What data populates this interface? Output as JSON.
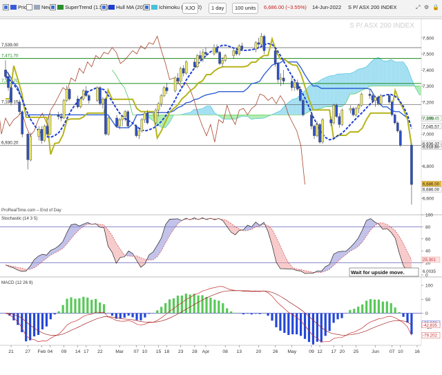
{
  "toolbar": {
    "items": [
      {
        "label": "Price",
        "checked": true,
        "swatch": "#3a5bd9"
      },
      {
        "label": "News",
        "checked": false,
        "swatch": "#9aa7b8"
      },
      {
        "label": "SuperTrend (1.5 7)",
        "checked": true,
        "swatch": "#2a8e2a"
      },
      {
        "label": "Hull MA (20)",
        "checked": true,
        "swatch": "#1f3fd0"
      },
      {
        "label": "Ichimoku (9 26 52)",
        "checked": true,
        "swatch": "#4ac0d8"
      }
    ],
    "symbol": "XJO",
    "period": "1 day",
    "units": "100 units",
    "price_change": "6,686.00 (−3.55%)",
    "date": "14-Jun-2022",
    "instrument_name": "S P/ ASX 200 INDEX",
    "icon_names": [
      "expand-icon",
      "settings-icon",
      "lock-icon"
    ]
  },
  "colors": {
    "bull_candle": "#e8e46a",
    "bear_candle": "#2d50c8",
    "supertrend": "#b5b41a",
    "hull": "#1e3fd2",
    "kumo_bull": "#8fd8ef",
    "kumo_bear": "#9ee99e",
    "tenkan_kijun": "#2e5fd0",
    "lagging": "#a5442a",
    "hline_green": "#1b8a1b",
    "hline_gray": "#555555",
    "macd_pos": "#58c858",
    "macd_neg": "#2347d9",
    "macd_line": "#c62a2a"
  },
  "chart_data": [
    {
      "type": "candlestick",
      "title": "S P/ ASX 200 INDEX",
      "footer": "ProRealTime.com – End of Day",
      "y_ticks": [
        7600,
        7500,
        7400,
        7300,
        7200,
        7100,
        7000,
        6800,
        6600
      ],
      "y_tick_labels": [
        "7,600",
        "7,500",
        "7,400",
        "7,300",
        "7,200",
        "7,100",
        "7,000",
        "6,800",
        "6,600"
      ],
      "ylim": [
        6510,
        7720
      ],
      "horizontal_levels": [
        {
          "value": 7539.0,
          "label": "7,539.00",
          "color": "gray"
        },
        {
          "value": 7471.7,
          "label": "7,471.70",
          "color": "green"
        },
        {
          "value": 7316,
          "label": "7,316.70",
          "color": "green"
        },
        {
          "value": 7183.15,
          "label": "7,183.15",
          "color": "gray"
        },
        {
          "value": 6930.2,
          "label": "6,930.20",
          "color": "gray"
        }
      ],
      "right_value_labels": [
        "7,095.45",
        "7,045.57",
        "6,936.37",
        "6,918.80",
        "6,686.00",
        "6,686.00"
      ],
      "candles": [
        {
          "d": "2022-01-19",
          "o": 7400,
          "h": 7460,
          "l": 7340,
          "c": 7360
        },
        {
          "d": "2022-01-20",
          "o": 7360,
          "h": 7385,
          "l": 7270,
          "c": 7290
        },
        {
          "d": "2022-01-21",
          "o": 7290,
          "h": 7310,
          "l": 7180,
          "c": 7200
        },
        {
          "d": "2022-01-24",
          "o": 7200,
          "h": 7215,
          "l": 7120,
          "c": 7140
        },
        {
          "d": "2022-01-25",
          "o": 7140,
          "h": 7150,
          "l": 6980,
          "c": 7000
        },
        {
          "d": "2022-01-27",
          "o": 7000,
          "h": 7010,
          "l": 6780,
          "c": 6840
        },
        {
          "d": "2022-01-28",
          "o": 6840,
          "h": 7010,
          "l": 6830,
          "c": 6985
        },
        {
          "d": "2022-01-31",
          "o": 6985,
          "h": 7050,
          "l": 6960,
          "c": 7030
        },
        {
          "d": "2022-02-01",
          "o": 7030,
          "h": 7050,
          "l": 6940,
          "c": 6960
        },
        {
          "d": "2022-02-02",
          "o": 6960,
          "h": 7060,
          "l": 6950,
          "c": 7050
        },
        {
          "d": "2022-02-03",
          "o": 7050,
          "h": 7070,
          "l": 6980,
          "c": 7000
        },
        {
          "d": "2022-02-04",
          "o": 7000,
          "h": 7130,
          "l": 6995,
          "c": 7120
        },
        {
          "d": "2022-02-07",
          "o": 7120,
          "h": 7140,
          "l": 7090,
          "c": 7110
        },
        {
          "d": "2022-02-08",
          "o": 7110,
          "h": 7130,
          "l": 7080,
          "c": 7100
        },
        {
          "d": "2022-02-09",
          "o": 7100,
          "h": 7220,
          "l": 7095,
          "c": 7210
        },
        {
          "d": "2022-02-10",
          "o": 7210,
          "h": 7300,
          "l": 7200,
          "c": 7280
        },
        {
          "d": "2022-02-11",
          "o": 7280,
          "h": 7290,
          "l": 7210,
          "c": 7220
        },
        {
          "d": "2022-02-14",
          "o": 7220,
          "h": 7240,
          "l": 7160,
          "c": 7170
        },
        {
          "d": "2022-02-15",
          "o": 7170,
          "h": 7230,
          "l": 7160,
          "c": 7220
        },
        {
          "d": "2022-02-16",
          "o": 7220,
          "h": 7280,
          "l": 7210,
          "c": 7270
        },
        {
          "d": "2022-02-17",
          "o": 7270,
          "h": 7300,
          "l": 7230,
          "c": 7240
        },
        {
          "d": "2022-02-18",
          "o": 7240,
          "h": 7250,
          "l": 7190,
          "c": 7210
        },
        {
          "d": "2022-02-21",
          "o": 7210,
          "h": 7300,
          "l": 7200,
          "c": 7290
        },
        {
          "d": "2022-02-22",
          "o": 7290,
          "h": 7300,
          "l": 7180,
          "c": 7190
        },
        {
          "d": "2022-02-23",
          "o": 7190,
          "h": 7230,
          "l": 7160,
          "c": 7220
        },
        {
          "d": "2022-02-24",
          "o": 7220,
          "h": 7230,
          "l": 6990,
          "c": 7000
        },
        {
          "d": "2022-02-25",
          "o": 7000,
          "h": 7110,
          "l": 6990,
          "c": 7100
        },
        {
          "d": "2022-02-28",
          "o": 7100,
          "h": 7120,
          "l": 7040,
          "c": 7050
        },
        {
          "d": "2022-03-01",
          "o": 7050,
          "h": 7100,
          "l": 7030,
          "c": 7090
        },
        {
          "d": "2022-03-02",
          "o": 7090,
          "h": 7120,
          "l": 7050,
          "c": 7110
        },
        {
          "d": "2022-03-03",
          "o": 7110,
          "h": 7150,
          "l": 7080,
          "c": 7140
        },
        {
          "d": "2022-03-04",
          "o": 7140,
          "h": 7150,
          "l": 7040,
          "c": 7050
        },
        {
          "d": "2022-03-07",
          "o": 7050,
          "h": 7060,
          "l": 6980,
          "c": 6990
        },
        {
          "d": "2022-03-08",
          "o": 6990,
          "h": 7040,
          "l": 6970,
          "c": 7020
        },
        {
          "d": "2022-03-09",
          "o": 7020,
          "h": 7100,
          "l": 7010,
          "c": 7090
        },
        {
          "d": "2022-03-10",
          "o": 7090,
          "h": 7140,
          "l": 7070,
          "c": 7130
        },
        {
          "d": "2022-03-11",
          "o": 7130,
          "h": 7150,
          "l": 7060,
          "c": 7070
        },
        {
          "d": "2022-03-14",
          "o": 7070,
          "h": 7160,
          "l": 7060,
          "c": 7150
        },
        {
          "d": "2022-03-15",
          "o": 7150,
          "h": 7200,
          "l": 7110,
          "c": 7190
        },
        {
          "d": "2022-03-16",
          "o": 7190,
          "h": 7250,
          "l": 7170,
          "c": 7240
        },
        {
          "d": "2022-03-17",
          "o": 7240,
          "h": 7300,
          "l": 7230,
          "c": 7290
        },
        {
          "d": "2022-03-18",
          "o": 7290,
          "h": 7320,
          "l": 7250,
          "c": 7270
        },
        {
          "d": "2022-03-21",
          "o": 7270,
          "h": 7360,
          "l": 7260,
          "c": 7350
        },
        {
          "d": "2022-03-22",
          "o": 7350,
          "h": 7380,
          "l": 7310,
          "c": 7330
        },
        {
          "d": "2022-03-23",
          "o": 7330,
          "h": 7420,
          "l": 7320,
          "c": 7410
        },
        {
          "d": "2022-03-24",
          "o": 7410,
          "h": 7430,
          "l": 7360,
          "c": 7380
        },
        {
          "d": "2022-03-25",
          "o": 7380,
          "h": 7460,
          "l": 7370,
          "c": 7450
        },
        {
          "d": "2022-03-28",
          "o": 7450,
          "h": 7470,
          "l": 7410,
          "c": 7420
        },
        {
          "d": "2022-03-29",
          "o": 7420,
          "h": 7500,
          "l": 7410,
          "c": 7490
        },
        {
          "d": "2022-03-30",
          "o": 7490,
          "h": 7520,
          "l": 7460,
          "c": 7470
        },
        {
          "d": "2022-03-31",
          "o": 7470,
          "h": 7530,
          "l": 7450,
          "c": 7510
        },
        {
          "d": "2022-04-01",
          "o": 7510,
          "h": 7540,
          "l": 7480,
          "c": 7500
        },
        {
          "d": "2022-04-04",
          "o": 7500,
          "h": 7560,
          "l": 7490,
          "c": 7540
        },
        {
          "d": "2022-04-05",
          "o": 7540,
          "h": 7560,
          "l": 7500,
          "c": 7510
        },
        {
          "d": "2022-04-06",
          "o": 7510,
          "h": 7520,
          "l": 7430,
          "c": 7440
        },
        {
          "d": "2022-04-07",
          "o": 7440,
          "h": 7480,
          "l": 7420,
          "c": 7460
        },
        {
          "d": "2022-04-08",
          "o": 7460,
          "h": 7500,
          "l": 7450,
          "c": 7490
        },
        {
          "d": "2022-04-11",
          "o": 7490,
          "h": 7530,
          "l": 7470,
          "c": 7520
        },
        {
          "d": "2022-04-12",
          "o": 7520,
          "h": 7540,
          "l": 7490,
          "c": 7500
        },
        {
          "d": "2022-04-13",
          "o": 7500,
          "h": 7560,
          "l": 7490,
          "c": 7550
        },
        {
          "d": "2022-04-14",
          "o": 7550,
          "h": 7570,
          "l": 7520,
          "c": 7530
        },
        {
          "d": "2022-04-19",
          "o": 7530,
          "h": 7580,
          "l": 7510,
          "c": 7570
        },
        {
          "d": "2022-04-20",
          "o": 7570,
          "h": 7600,
          "l": 7540,
          "c": 7560
        },
        {
          "d": "2022-04-21",
          "o": 7560,
          "h": 7630,
          "l": 7550,
          "c": 7610
        },
        {
          "d": "2022-04-22",
          "o": 7610,
          "h": 7620,
          "l": 7500,
          "c": 7520
        },
        {
          "d": "2022-04-26",
          "o": 7520,
          "h": 7530,
          "l": 7420,
          "c": 7440
        },
        {
          "d": "2022-04-27",
          "o": 7440,
          "h": 7450,
          "l": 7320,
          "c": 7340
        },
        {
          "d": "2022-04-28",
          "o": 7340,
          "h": 7380,
          "l": 7300,
          "c": 7350
        },
        {
          "d": "2022-04-29",
          "o": 7350,
          "h": 7400,
          "l": 7310,
          "c": 7330
        },
        {
          "d": "2022-05-02",
          "o": 7330,
          "h": 7360,
          "l": 7270,
          "c": 7290
        },
        {
          "d": "2022-05-03",
          "o": 7290,
          "h": 7340,
          "l": 7270,
          "c": 7320
        },
        {
          "d": "2022-05-04",
          "o": 7320,
          "h": 7340,
          "l": 7270,
          "c": 7280
        },
        {
          "d": "2022-05-05",
          "o": 7280,
          "h": 7300,
          "l": 7200,
          "c": 7210
        },
        {
          "d": "2022-05-06",
          "o": 7210,
          "h": 7220,
          "l": 7110,
          "c": 7120
        },
        {
          "d": "2022-05-09",
          "o": 7120,
          "h": 7130,
          "l": 7030,
          "c": 7050
        },
        {
          "d": "2022-05-10",
          "o": 7050,
          "h": 7060,
          "l": 6970,
          "c": 6990
        },
        {
          "d": "2022-05-11",
          "o": 6990,
          "h": 7080,
          "l": 6980,
          "c": 7060
        },
        {
          "d": "2022-05-12",
          "o": 7060,
          "h": 7070,
          "l": 6940,
          "c": 6950
        },
        {
          "d": "2022-05-13",
          "o": 6950,
          "h": 7100,
          "l": 6940,
          "c": 7090
        },
        {
          "d": "2022-05-16",
          "o": 7090,
          "h": 7110,
          "l": 7050,
          "c": 7070
        },
        {
          "d": "2022-05-17",
          "o": 7070,
          "h": 7190,
          "l": 7060,
          "c": 7180
        },
        {
          "d": "2022-05-18",
          "o": 7180,
          "h": 7190,
          "l": 7100,
          "c": 7110
        },
        {
          "d": "2022-05-19",
          "o": 7110,
          "h": 7130,
          "l": 7040,
          "c": 7060
        },
        {
          "d": "2022-05-20",
          "o": 7060,
          "h": 7160,
          "l": 7050,
          "c": 7150
        },
        {
          "d": "2022-05-23",
          "o": 7150,
          "h": 7180,
          "l": 7130,
          "c": 7160
        },
        {
          "d": "2022-05-24",
          "o": 7160,
          "h": 7170,
          "l": 7110,
          "c": 7120
        },
        {
          "d": "2022-05-25",
          "o": 7120,
          "h": 7170,
          "l": 7110,
          "c": 7160
        },
        {
          "d": "2022-05-26",
          "o": 7160,
          "h": 7190,
          "l": 7130,
          "c": 7180
        },
        {
          "d": "2022-05-27",
          "o": 7180,
          "h": 7260,
          "l": 7170,
          "c": 7250
        },
        {
          "d": "2022-05-30",
          "o": 7250,
          "h": 7280,
          "l": 7220,
          "c": 7240
        },
        {
          "d": "2022-05-31",
          "o": 7240,
          "h": 7250,
          "l": 7190,
          "c": 7210
        },
        {
          "d": "2022-06-01",
          "o": 7210,
          "h": 7240,
          "l": 7170,
          "c": 7230
        },
        {
          "d": "2022-06-02",
          "o": 7230,
          "h": 7240,
          "l": 7180,
          "c": 7190
        },
        {
          "d": "2022-06-03",
          "o": 7190,
          "h": 7250,
          "l": 7180,
          "c": 7240
        },
        {
          "d": "2022-06-06",
          "o": 7240,
          "h": 7250,
          "l": 7190,
          "c": 7200
        },
        {
          "d": "2022-06-07",
          "o": 7200,
          "h": 7210,
          "l": 7110,
          "c": 7120
        },
        {
          "d": "2022-06-08",
          "o": 7120,
          "h": 7130,
          "l": 7060,
          "c": 7070
        },
        {
          "d": "2022-06-09",
          "o": 7070,
          "h": 7080,
          "l": 7010,
          "c": 7020
        },
        {
          "d": "2022-06-10",
          "o": 7020,
          "h": 7030,
          "l": 6920,
          "c": 6930
        },
        {
          "d": "2022-06-14",
          "o": 6930,
          "h": 6940,
          "l": 6560,
          "c": 6686
        }
      ]
    },
    {
      "type": "line",
      "title": "Stochastic (14 3 5)",
      "y_ticks": [
        100,
        80,
        60,
        40,
        20,
        0
      ],
      "levels": [
        80,
        20
      ],
      "ylim": [
        0,
        100
      ],
      "right_value_labels": [
        "25.301",
        "6.0035"
      ],
      "annotation": "Wait for upside move."
    },
    {
      "type": "bar",
      "title": "MACD (12 26 9)",
      "y_ticks": [
        100,
        50,
        0,
        -50
      ],
      "ylim": [
        -115,
        130
      ],
      "right_value_labels": [
        "-36.368",
        "-42.835",
        "-79.202"
      ]
    }
  ],
  "x_axis_labels": [
    {
      "d": "2022-01-21",
      "t": "21"
    },
    {
      "d": "2022-01-27",
      "t": "27"
    },
    {
      "d": "2022-02-01",
      "t": "Feb"
    },
    {
      "d": "2022-02-04",
      "t": "04"
    },
    {
      "d": "2022-02-09",
      "t": "09"
    },
    {
      "d": "2022-02-14",
      "t": "14"
    },
    {
      "d": "2022-02-17",
      "t": "17"
    },
    {
      "d": "2022-02-22",
      "t": "22"
    },
    {
      "d": "2022-03-01",
      "t": "Mar"
    },
    {
      "d": "2022-03-07",
      "t": "07"
    },
    {
      "d": "2022-03-10",
      "t": "10"
    },
    {
      "d": "2022-03-15",
      "t": "15"
    },
    {
      "d": "2022-03-18",
      "t": "18"
    },
    {
      "d": "2022-03-23",
      "t": "23"
    },
    {
      "d": "2022-03-28",
      "t": "28"
    },
    {
      "d": "2022-04-01",
      "t": "Apr"
    },
    {
      "d": "2022-04-08",
      "t": "08"
    },
    {
      "d": "2022-04-13",
      "t": "13"
    },
    {
      "d": "2022-04-20",
      "t": "20"
    },
    {
      "d": "2022-04-26",
      "t": "26"
    },
    {
      "d": "2022-05-02",
      "t": "May"
    },
    {
      "d": "2022-05-09",
      "t": "09"
    },
    {
      "d": "2022-05-12",
      "t": "12"
    },
    {
      "d": "2022-05-17",
      "t": "17"
    },
    {
      "d": "2022-05-20",
      "t": "20"
    },
    {
      "d": "2022-05-25",
      "t": "25"
    },
    {
      "d": "2022-06-01",
      "t": "Jun"
    },
    {
      "d": "2022-06-07",
      "t": "07"
    },
    {
      "d": "2022-06-10",
      "t": "10"
    },
    {
      "d": "2022-06-16",
      "t": "16"
    }
  ]
}
